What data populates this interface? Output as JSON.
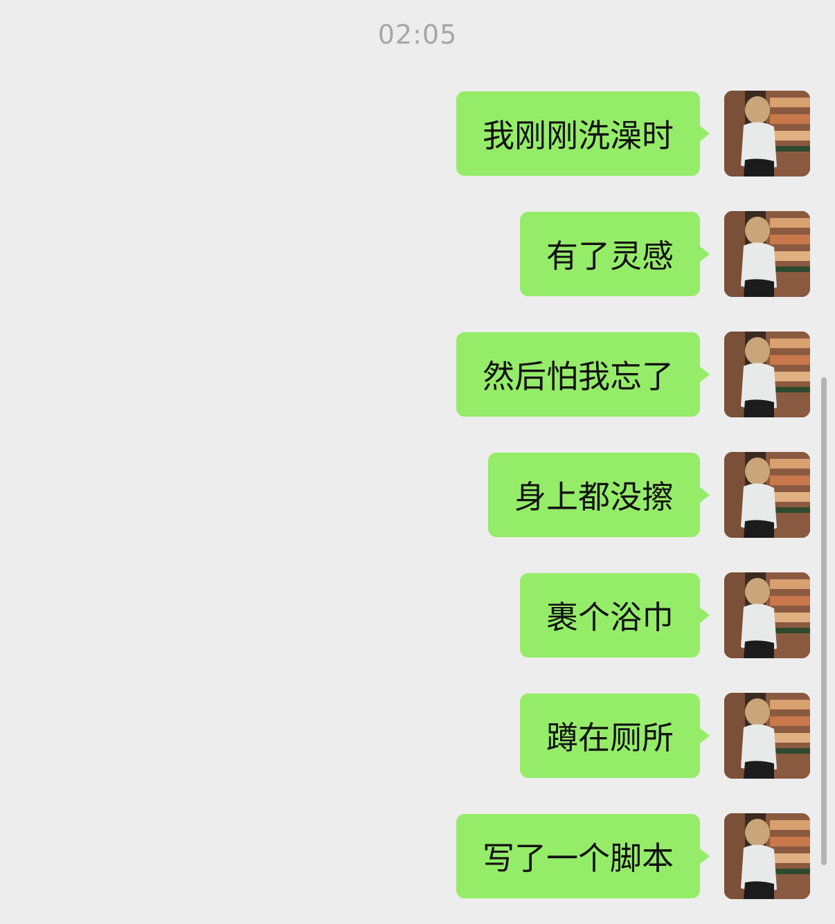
{
  "chat": {
    "timestamp": "02:05",
    "messages": [
      {
        "text": "我刚刚洗澡时"
      },
      {
        "text": "有了灵感"
      },
      {
        "text": "然后怕我忘了"
      },
      {
        "text": "身上都没擦"
      },
      {
        "text": "裹个浴巾"
      },
      {
        "text": "蹲在厕所"
      },
      {
        "text": "写了一个脚本"
      }
    ]
  },
  "colors": {
    "background": "#ededed",
    "bubble": "#95ec69",
    "timestamp": "#a6a6a6"
  },
  "icons": {
    "avatar": "user-avatar-photo"
  }
}
